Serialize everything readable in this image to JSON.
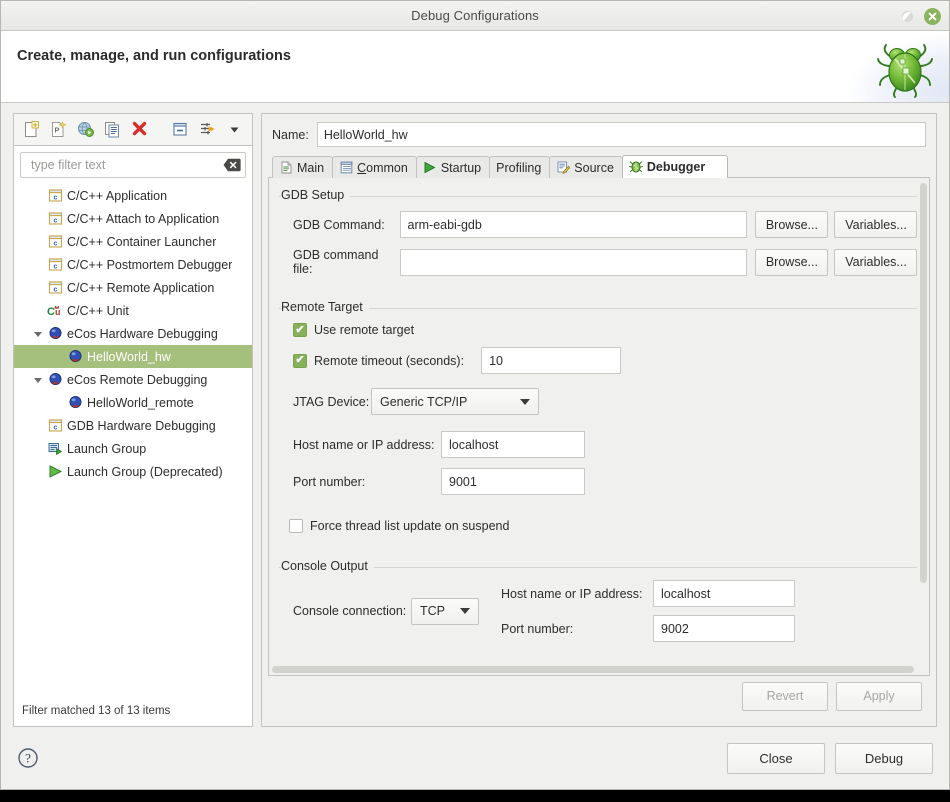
{
  "window": {
    "title": "Debug Configurations",
    "restore_icon": "restore-icon",
    "close_icon": "close-icon"
  },
  "banner": {
    "heading": "Create, manage, and run configurations",
    "logo_icon": "bug-logo-icon"
  },
  "toolbar": {
    "buttons": [
      {
        "name": "new-configuration-button",
        "icon": "new-document-icon",
        "tooltip": "New launch configuration"
      },
      {
        "name": "new-prototype-button",
        "icon": "new-prototype-icon",
        "tooltip": "New prototype"
      },
      {
        "name": "export-button",
        "icon": "globe-icon",
        "tooltip": "Export"
      },
      {
        "name": "duplicate-button",
        "icon": "duplicate-icon",
        "tooltip": "Duplicate"
      },
      {
        "name": "delete-button",
        "icon": "delete-x-icon",
        "tooltip": "Delete"
      },
      {
        "name": "collapse-all-button",
        "icon": "collapse-all-icon",
        "tooltip": "Collapse All"
      },
      {
        "name": "filter-button",
        "icon": "filter-icon",
        "tooltip": "Filter"
      },
      {
        "name": "view-menu-button",
        "icon": "chevron-down-icon",
        "tooltip": "View Menu"
      }
    ]
  },
  "filter": {
    "placeholder": "type filter text",
    "value": "",
    "clear_icon": "clear-icon"
  },
  "tree": {
    "items": [
      {
        "label": "C/C++ Application",
        "icon": "c-app-icon",
        "level": 1,
        "expander": "none",
        "selected": false
      },
      {
        "label": "C/C++ Attach to Application",
        "icon": "c-app-icon",
        "level": 1,
        "expander": "none",
        "selected": false
      },
      {
        "label": "C/C++ Container Launcher",
        "icon": "c-app-icon",
        "level": 1,
        "expander": "none",
        "selected": false
      },
      {
        "label": "C/C++ Postmortem Debugger",
        "icon": "c-app-icon",
        "level": 1,
        "expander": "none",
        "selected": false
      },
      {
        "label": "C/C++ Remote Application",
        "icon": "c-app-icon",
        "level": 1,
        "expander": "none",
        "selected": false
      },
      {
        "label": "C/C++ Unit",
        "icon": "cpp-unit-icon",
        "level": 1,
        "expander": "none",
        "selected": false
      },
      {
        "label": "eCos Hardware Debugging",
        "icon": "ecos-icon",
        "level": 0,
        "expander": "expanded",
        "selected": false
      },
      {
        "label": "HelloWorld_hw",
        "icon": "ecos-icon",
        "level": 2,
        "expander": "none",
        "selected": true
      },
      {
        "label": "eCos Remote Debugging",
        "icon": "ecos-icon",
        "level": 0,
        "expander": "expanded",
        "selected": false
      },
      {
        "label": "HelloWorld_remote",
        "icon": "ecos-icon",
        "level": 2,
        "expander": "none",
        "selected": false
      },
      {
        "label": "GDB Hardware Debugging",
        "icon": "c-app-icon",
        "level": 1,
        "expander": "none",
        "selected": false
      },
      {
        "label": "Launch Group",
        "icon": "launch-group-icon",
        "level": 1,
        "expander": "none",
        "selected": false
      },
      {
        "label": "Launch Group (Deprecated)",
        "icon": "launch-group-deprecated-icon",
        "level": 1,
        "expander": "none",
        "selected": false
      }
    ],
    "status": "Filter matched 13 of 13 items"
  },
  "name_field": {
    "label": "Name:",
    "value": "HelloWorld_hw"
  },
  "tabs": [
    {
      "label": "Main",
      "icon": "document-icon",
      "active": false,
      "mnemonic": ""
    },
    {
      "label": "Common",
      "icon": "common-icon",
      "active": false,
      "mnemonic": "C"
    },
    {
      "label": "Startup",
      "icon": "run-arrow-icon",
      "active": false,
      "mnemonic": ""
    },
    {
      "label": "Profiling",
      "icon": "",
      "active": false,
      "mnemonic": ""
    },
    {
      "label": "Source",
      "icon": "source-icon",
      "active": false,
      "mnemonic": ""
    },
    {
      "label": "Debugger",
      "icon": "debugger-bug-icon",
      "active": true,
      "mnemonic": ""
    }
  ],
  "debugger_tab": {
    "gdb_setup": {
      "title": "GDB Setup",
      "gdb_command": {
        "label": "GDB Command:",
        "value": "arm-eabi-gdb",
        "browse_label": "Browse...",
        "variables_label": "Variables..."
      },
      "gdb_command_file": {
        "label": "GDB command file:",
        "value": "",
        "browse_label": "Browse...",
        "variables_label": "Variables..."
      }
    },
    "remote_target": {
      "title": "Remote Target",
      "use_remote_target": {
        "label": "Use remote target",
        "checked": true
      },
      "remote_timeout": {
        "label": "Remote timeout (seconds):",
        "checked": true,
        "value": "10"
      },
      "jtag_device": {
        "label": "JTAG Device:",
        "value": "Generic TCP/IP"
      },
      "host_name": {
        "label": "Host name or IP address:",
        "value": "localhost"
      },
      "port_number": {
        "label": "Port number:",
        "value": "9001"
      }
    },
    "force_thread_list": {
      "label": "Force thread list update on suspend",
      "checked": false
    },
    "console_output": {
      "title": "Console Output",
      "console_connection": {
        "label": "Console connection:",
        "value": "TCP"
      },
      "host_name": {
        "label": "Host name or IP address:",
        "value": "localhost"
      },
      "port_number": {
        "label": "Port number:",
        "value": "9002"
      }
    }
  },
  "action_buttons": {
    "revert": "Revert",
    "apply": "Apply"
  },
  "footer": {
    "help_icon": "help-question-icon",
    "close": "Close",
    "debug": "Debug"
  },
  "colors": {
    "selection_green": "#a5bf7d",
    "checkbox_green": "#86b05a",
    "window_bg": "#f0f0ef",
    "close_button_green": "#8cb45c"
  }
}
